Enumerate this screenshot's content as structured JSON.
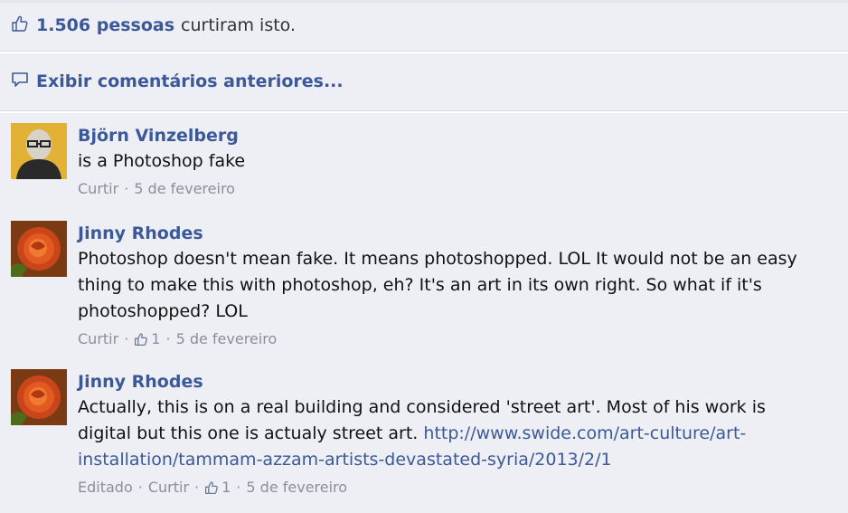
{
  "likes": {
    "count_text": "1.506 pessoas",
    "suffix": "curtiram isto."
  },
  "previous_comments": {
    "label": "Exibir comentários anteriores..."
  },
  "comments": [
    {
      "author": "Björn Vinzelberg",
      "text": "is a Photoshop fake",
      "actions": {
        "like": "Curtir"
      },
      "date": "5 de fevereiro"
    },
    {
      "author": "Jinny Rhodes",
      "text": "Photoshop doesn't mean fake. It means photoshopped. LOL It would not be an easy thing to make this with photoshop, eh? It's an art in its own right. So what if it's photoshopped? LOL",
      "actions": {
        "like": "Curtir"
      },
      "like_count": "1",
      "date": "5 de fevereiro"
    },
    {
      "author": "Jinny Rhodes",
      "text": "Actually, this is on a real building and considered 'street art'. Most of his work is digital but this one is actualy street art.",
      "link": "http://www.swide.com/art-culture/art-installation/tammam-azzam-artists-devastated-syria/2013/2/1",
      "actions": {
        "edited": "Editado",
        "like": "Curtir"
      },
      "like_count": "1",
      "date": "5 de fevereiro"
    }
  ],
  "colors": {
    "link_blue": "#3b5998",
    "meta_gray": "#8a8f99",
    "background": "#edeff4"
  },
  "icons": {
    "likes": "thumbs-up-icon",
    "previous_comments": "comment-bubble-icon",
    "comment_like": "thumbs-up-icon"
  }
}
